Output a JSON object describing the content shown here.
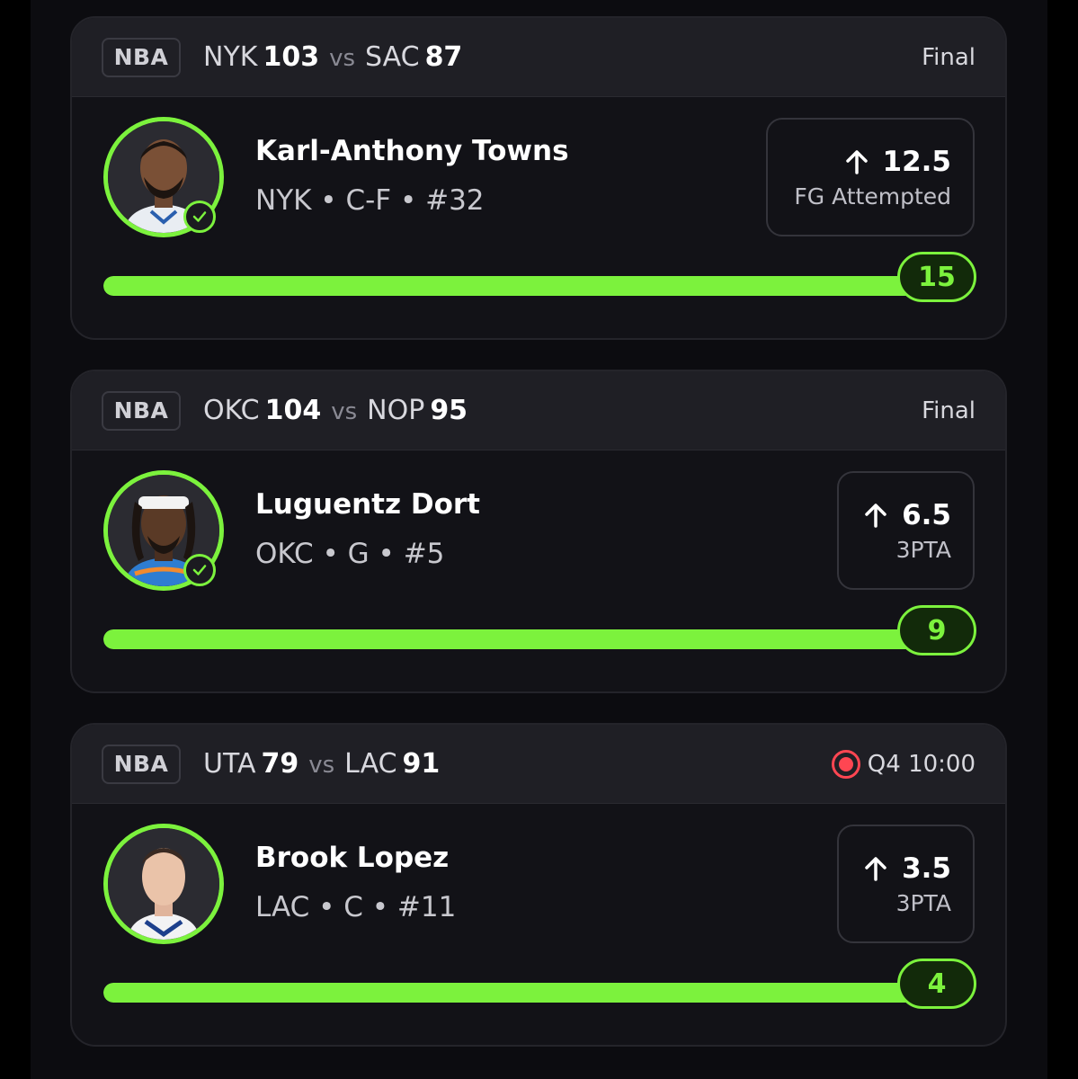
{
  "colors": {
    "accent": "#7cf23d",
    "live": "#ff4652",
    "card_bg": "#121217",
    "header_bg": "#1f1f25"
  },
  "cards": [
    {
      "league": "NBA",
      "team1": "NYK",
      "score1": "103",
      "vs": "vs",
      "team2": "SAC",
      "score2": "87",
      "status": "Final",
      "live": false,
      "player_name": "Karl-Anthony Towns",
      "player_meta": "NYK • C-F • #32",
      "line_value": "12.5",
      "direction_icon": "arrow-up-icon",
      "line_stat": "FG Attempted",
      "actual": "15",
      "progress_fraction": 1.0,
      "completed": true
    },
    {
      "league": "NBA",
      "team1": "OKC",
      "score1": "104",
      "vs": "vs",
      "team2": "NOP",
      "score2": "95",
      "status": "Final",
      "live": false,
      "player_name": "Luguentz Dort",
      "player_meta": "OKC • G • #5",
      "line_value": "6.5",
      "direction_icon": "arrow-up-icon",
      "line_stat": "3PTA",
      "actual": "9",
      "progress_fraction": 1.0,
      "completed": true
    },
    {
      "league": "NBA",
      "team1": "UTA",
      "score1": "79",
      "vs": "vs",
      "team2": "LAC",
      "score2": "91",
      "status": "Q4 10:00",
      "live": true,
      "player_name": "Brook Lopez",
      "player_meta": "LAC • C • #11",
      "line_value": "3.5",
      "direction_icon": "arrow-up-icon",
      "line_stat": "3PTA",
      "actual": "4",
      "progress_fraction": 1.0,
      "completed": false
    }
  ]
}
